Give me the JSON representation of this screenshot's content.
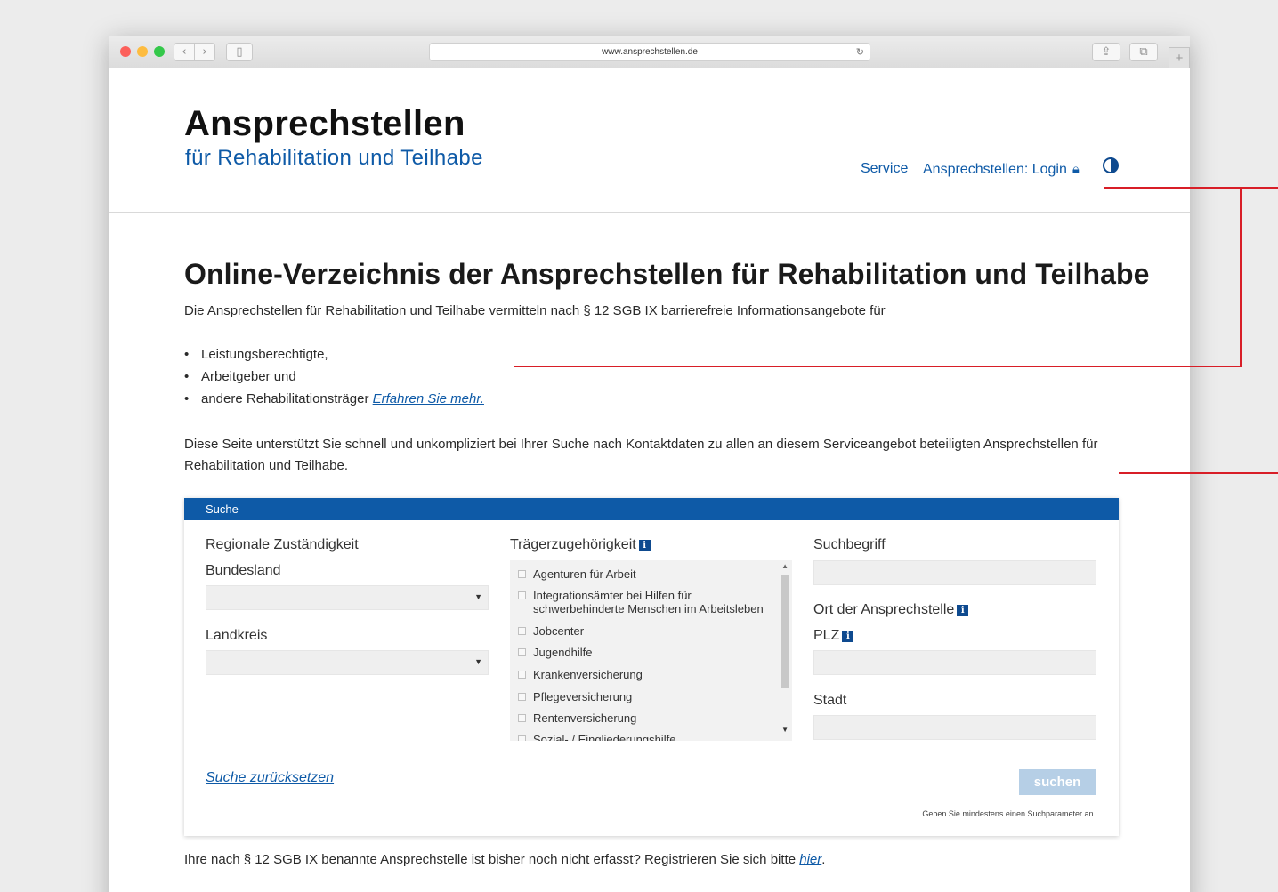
{
  "browser": {
    "url": "www.ansprechstellen.de"
  },
  "site": {
    "title": "Ansprechstellen",
    "subtitle": "für Rehabilitation und Teilhabe"
  },
  "nav": {
    "service": "Service",
    "login": "Ansprechstellen: Login"
  },
  "main": {
    "heading": "Online-Verzeichnis der Ansprechstellen für Rehabilitation und Teilhabe",
    "intro": "Die Ansprechstellen für Rehabilitation und Teilhabe vermitteln nach § 12 SGB IX barrierefreie Informationsangebote für",
    "bullets": [
      "Leistungsberechtigte,",
      "Arbeitgeber und",
      "andere Rehabilitationsträger"
    ],
    "more_link": "Erfahren Sie mehr.",
    "description": "Diese Seite unterstützt Sie schnell und unkompliziert bei Ihrer Suche nach Kontaktdaten zu allen an diesem Serviceangebot beteiligten Ansprechstellen für Rehabilitation und Teilhabe."
  },
  "search": {
    "panel_title": "Suche",
    "regional_label": "Regionale Zuständigkeit",
    "bundesland_label": "Bundesland",
    "bundesland_value": "",
    "landkreis_label": "Landkreis",
    "landkreis_value": "",
    "traeger_label": "Trägerzugehörigkeit",
    "traeger_options": [
      "Agenturen für Arbeit",
      "Integrationsämter bei Hilfen für schwerbehinderte Menschen im Arbeitsleben",
      "Jobcenter",
      "Jugendhilfe",
      "Krankenversicherung",
      "Pflegeversicherung",
      "Rentenversicherung",
      "Sozial- / Eingliederungshilfe"
    ],
    "suchbegriff_label": "Suchbegriff",
    "suchbegriff_value": "",
    "ort_label": "Ort der Ansprechstelle",
    "plz_label": "PLZ",
    "plz_value": "",
    "stadt_label": "Stadt",
    "stadt_value": "",
    "reset_link": "Suche zurücksetzen",
    "submit_label": "suchen",
    "hint": "Geben Sie mindestens einen Suchparameter an."
  },
  "footer": {
    "text": "Ihre nach § 12 SGB IX benannte Ansprechstelle ist bisher noch nicht erfasst? Registrieren Sie sich bitte",
    "link": "hier",
    "end": "."
  },
  "colors": {
    "brand_blue": "#0e5aa7",
    "annotation_red": "#d81e27",
    "button_disabled": "#b6cfe6"
  }
}
